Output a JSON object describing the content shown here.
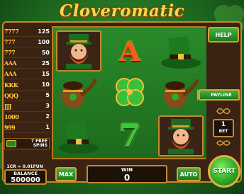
{
  "title": "Cloveromatic",
  "paytable": {
    "rows": [
      {
        "symbol": "7777",
        "payout": "125"
      },
      {
        "symbol": "777",
        "payout": "100"
      },
      {
        "symbol": "777",
        "payout": "50"
      },
      {
        "symbol": "AAA",
        "payout": "25"
      },
      {
        "symbol": "AAA",
        "payout": "15"
      },
      {
        "symbol": "KKK",
        "payout": "10"
      },
      {
        "symbol": "QQQ",
        "payout": "5"
      },
      {
        "symbol": "JJJ",
        "payout": "3"
      },
      {
        "symbol": "1000",
        "payout": "2"
      },
      {
        "symbol": "999",
        "payout": "1"
      }
    ],
    "free_spins_line1": "7 FREE",
    "free_spins_line2": "SPINS"
  },
  "reels": {
    "col1": [
      "leprechaun",
      "pipe",
      "hat"
    ],
    "col2": [
      "A",
      "clover",
      "7"
    ],
    "col3": [
      "hat",
      "pipe",
      "leprechaun"
    ]
  },
  "buttons": {
    "help": "HELP",
    "payline": "PAYLINE",
    "max": "MAX",
    "auto": "AUTO",
    "start": "START"
  },
  "bet": {
    "value": "1",
    "label": "BET"
  },
  "balance": {
    "credit_info": "1CR = 0.01FUN",
    "label": "BALANCE",
    "value": "500000"
  },
  "win": {
    "label": "WIN",
    "value": "0"
  },
  "colors": {
    "accent_gold": "#d8a030",
    "button_green": "#2faa2a",
    "frame_brown": "#3a2312"
  }
}
